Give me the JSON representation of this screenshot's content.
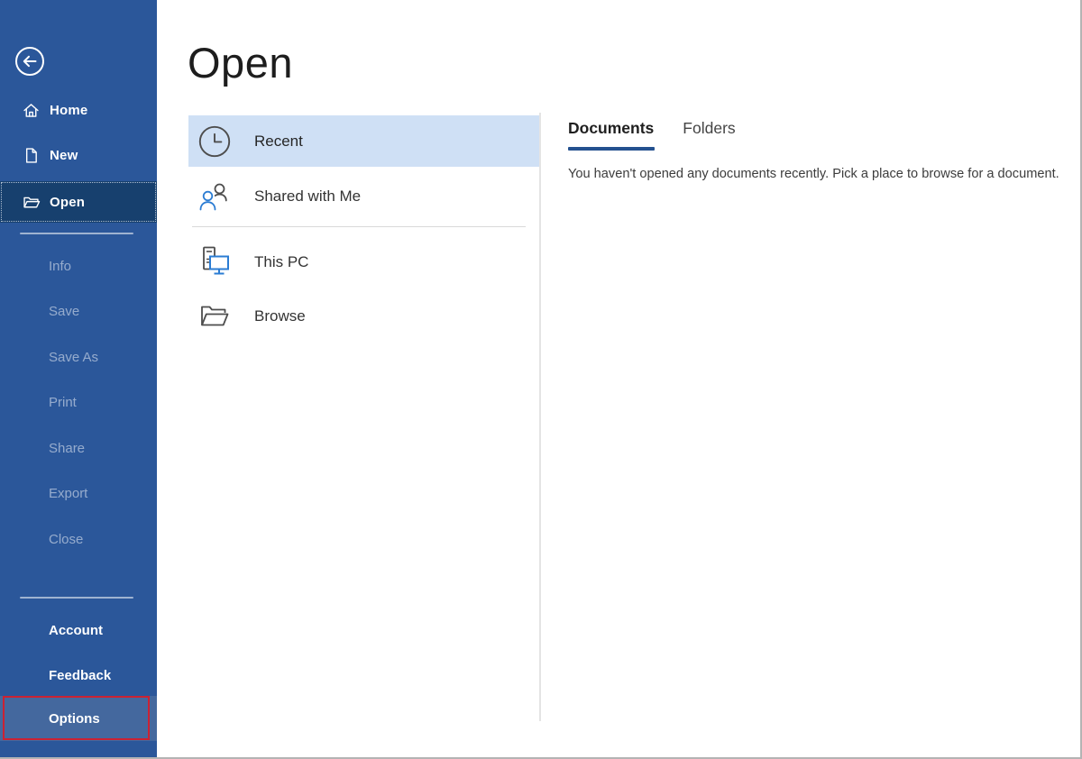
{
  "sidebar": {
    "nav_items": [
      {
        "label": "Home",
        "icon": "home-icon"
      },
      {
        "label": "New",
        "icon": "new-document-icon"
      },
      {
        "label": "Open",
        "icon": "open-folder-icon",
        "selected": true
      }
    ],
    "disabled_items": [
      "Info",
      "Save",
      "Save As",
      "Print",
      "Share",
      "Export",
      "Close"
    ],
    "footer_items": [
      "Account",
      "Feedback",
      "Options"
    ],
    "options_highlighted": true
  },
  "content": {
    "title": "Open",
    "places": [
      {
        "label": "Recent",
        "icon": "clock-icon",
        "selected": true
      },
      {
        "label": "Shared with Me",
        "icon": "people-icon"
      },
      {
        "label": "This PC",
        "icon": "computer-icon"
      },
      {
        "label": "Browse",
        "icon": "browse-folder-icon"
      }
    ],
    "panel": {
      "tabs": [
        {
          "label": "Documents",
          "active": true
        },
        {
          "label": "Folders",
          "active": false
        }
      ],
      "empty_message": "You haven't opened any documents recently. Pick a place to browse for a document."
    }
  },
  "colors": {
    "sidebar_blue": "#2b579a",
    "sidebar_selected": "#17406e",
    "options_row_highlight": "#44689e",
    "annotation_red": "#cb2233",
    "recent_row_highlight": "#cfe0f5",
    "tab_underline": "#24518f",
    "accent_icon_blue": "#2b7cd3"
  }
}
